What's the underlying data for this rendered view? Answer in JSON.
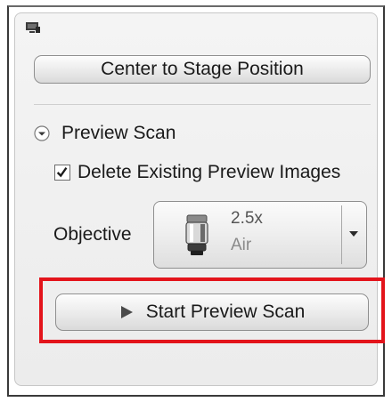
{
  "panel": {
    "header_icon": "monitor-icon",
    "center_button_label": "Center to Stage Position"
  },
  "preview_scan": {
    "expander_icon": "chevron-down-circle-icon",
    "header_label": "Preview Scan",
    "delete_checkbox": {
      "label": "Delete Existing Preview Images",
      "checked": true
    },
    "objective": {
      "label": "Objective",
      "icon": "objective-lens-icon",
      "magnification": "2.5x",
      "medium": "Air",
      "dropdown_icon": "caret-down-icon"
    },
    "start_button": {
      "icon": "play-icon",
      "label": "Start Preview Scan"
    }
  },
  "colors": {
    "highlight": "#e3141b",
    "panel_background": "#efefef"
  }
}
